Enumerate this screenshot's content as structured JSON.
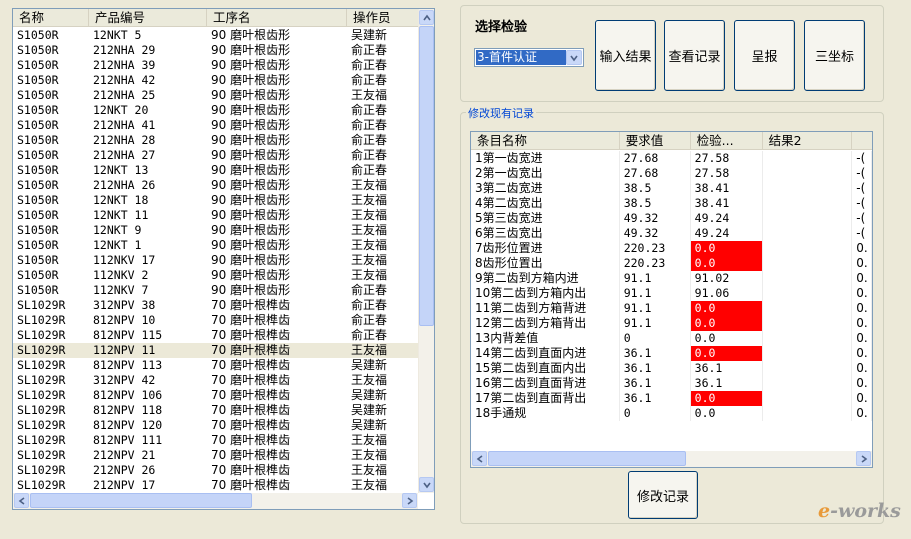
{
  "left_list": {
    "columns": [
      "名称",
      "产品编号",
      "工序名",
      "操作员"
    ],
    "rows": [
      [
        "S1050R",
        "12NKT 5",
        "90 磨叶根齿形",
        "吴建新"
      ],
      [
        "S1050R",
        "212NHA 29",
        "90 磨叶根齿形",
        "俞正春"
      ],
      [
        "S1050R",
        "212NHA 39",
        "90 磨叶根齿形",
        "俞正春"
      ],
      [
        "S1050R",
        "212NHA 42",
        "90 磨叶根齿形",
        "俞正春"
      ],
      [
        "S1050R",
        "212NHA 25",
        "90 磨叶根齿形",
        "王友福"
      ],
      [
        "S1050R",
        "12NKT 20",
        "90 磨叶根齿形",
        "俞正春"
      ],
      [
        "S1050R",
        "212NHA 41",
        "90 磨叶根齿形",
        "俞正春"
      ],
      [
        "S1050R",
        "212NHA 28",
        "90 磨叶根齿形",
        "俞正春"
      ],
      [
        "S1050R",
        "212NHA 27",
        "90 磨叶根齿形",
        "俞正春"
      ],
      [
        "S1050R",
        "12NKT 13",
        "90 磨叶根齿形",
        "俞正春"
      ],
      [
        "S1050R",
        "212NHA 26",
        "90 磨叶根齿形",
        "王友福"
      ],
      [
        "S1050R",
        "12NKT 18",
        "90 磨叶根齿形",
        "王友福"
      ],
      [
        "S1050R",
        "12NKT 11",
        "90 磨叶根齿形",
        "王友福"
      ],
      [
        "S1050R",
        "12NKT 9",
        "90 磨叶根齿形",
        "王友福"
      ],
      [
        "S1050R",
        "12NKT 1",
        "90 磨叶根齿形",
        "王友福"
      ],
      [
        "S1050R",
        "112NKV 17",
        "90 磨叶根齿形",
        "王友福"
      ],
      [
        "S1050R",
        "112NKV 2",
        "90 磨叶根齿形",
        "王友福"
      ],
      [
        "S1050R",
        "112NKV 7",
        "90 磨叶根齿形",
        "俞正春"
      ],
      [
        "SL1029R",
        "312NPV 38",
        "70 磨叶根榫齿",
        "俞正春"
      ],
      [
        "SL1029R",
        "812NPV 10",
        "70 磨叶根榫齿",
        "俞正春"
      ],
      [
        "SL1029R",
        "812NPV 115",
        "70 磨叶根榫齿",
        "俞正春"
      ],
      [
        "SL1029R",
        "112NPV 11",
        "70 磨叶根榫齿",
        "王友福"
      ],
      [
        "SL1029R",
        "812NPV 113",
        "70 磨叶根榫齿",
        "吴建新"
      ],
      [
        "SL1029R",
        "312NPV 42",
        "70 磨叶根榫齿",
        "王友福"
      ],
      [
        "SL1029R",
        "812NPV 106",
        "70 磨叶根榫齿",
        "吴建新"
      ],
      [
        "SL1029R",
        "812NPV 118",
        "70 磨叶根榫齿",
        "吴建新"
      ],
      [
        "SL1029R",
        "812NPV 120",
        "70 磨叶根榫齿",
        "吴建新"
      ],
      [
        "SL1029R",
        "812NPV 111",
        "70 磨叶根榫齿",
        "王友福"
      ],
      [
        "SL1029R",
        "212NPV 21",
        "70 磨叶根榫齿",
        "王友福"
      ],
      [
        "SL1029R",
        "212NPV 26",
        "70 磨叶根榫齿",
        "王友福"
      ],
      [
        "SL1029R",
        "212NPV 17",
        "70 磨叶根榫齿",
        "王友福"
      ]
    ]
  },
  "inspection": {
    "title": "选择检验",
    "selected": "3-首件认证",
    "buttons": {
      "input": "输入结果",
      "view": "查看记录",
      "report": "呈报",
      "three_coord": "三坐标"
    }
  },
  "records": {
    "group_label": "修改现有记录",
    "columns": [
      "条目名称",
      "要求值",
      "检验...",
      "结果2",
      ""
    ],
    "rows": [
      [
        "1第一齿宽进",
        "27.68",
        "27.58",
        "",
        "-("
      ],
      [
        "2第一齿宽出",
        "27.68",
        "27.58",
        "",
        "-("
      ],
      [
        "3第二齿宽进",
        "38.5",
        "38.41",
        "",
        "-("
      ],
      [
        "4第二齿宽出",
        "38.5",
        "38.41",
        "",
        "-("
      ],
      [
        "5第三齿宽进",
        "49.32",
        "49.24",
        "",
        "-("
      ],
      [
        "6第三齿宽出",
        "49.32",
        "49.24",
        "",
        "-("
      ],
      [
        "7齿形位置进",
        "220.23",
        "0.0",
        "",
        "0."
      ],
      [
        "8齿形位置出",
        "220.23",
        "0.0",
        "",
        "0."
      ],
      [
        "9第二齿到方箱内进",
        "91.1",
        "91.02",
        "",
        "0."
      ],
      [
        "10第二齿到方箱内出",
        "91.1",
        "91.06",
        "",
        "0."
      ],
      [
        "11第二齿到方箱背进",
        "91.1",
        "0.0",
        "",
        "0."
      ],
      [
        "12第二齿到方箱背出",
        "91.1",
        "0.0",
        "",
        "0."
      ],
      [
        "13内背差值",
        "0",
        "0.0",
        "",
        "0."
      ],
      [
        "14第二齿到直面内进",
        "36.1",
        "0.0",
        "",
        "0."
      ],
      [
        "15第二齿到直面内出",
        "36.1",
        "36.1",
        "",
        "0."
      ],
      [
        "16第二齿到直面背进",
        "36.1",
        "36.1",
        "",
        "0."
      ],
      [
        "17第二齿到直面背出",
        "36.1",
        "0.0",
        "",
        "0."
      ],
      [
        "18手通规",
        "0",
        "0.0",
        "",
        "0."
      ]
    ],
    "failed_rows": [
      6,
      7,
      10,
      11,
      13,
      16
    ],
    "modify_button": "修改记录"
  },
  "watermark": {
    "e": "e",
    "rest": "-works"
  },
  "colors": {
    "fail": "#ff0000",
    "window_bg": "#ece9d8",
    "border": "#7f9db9"
  }
}
